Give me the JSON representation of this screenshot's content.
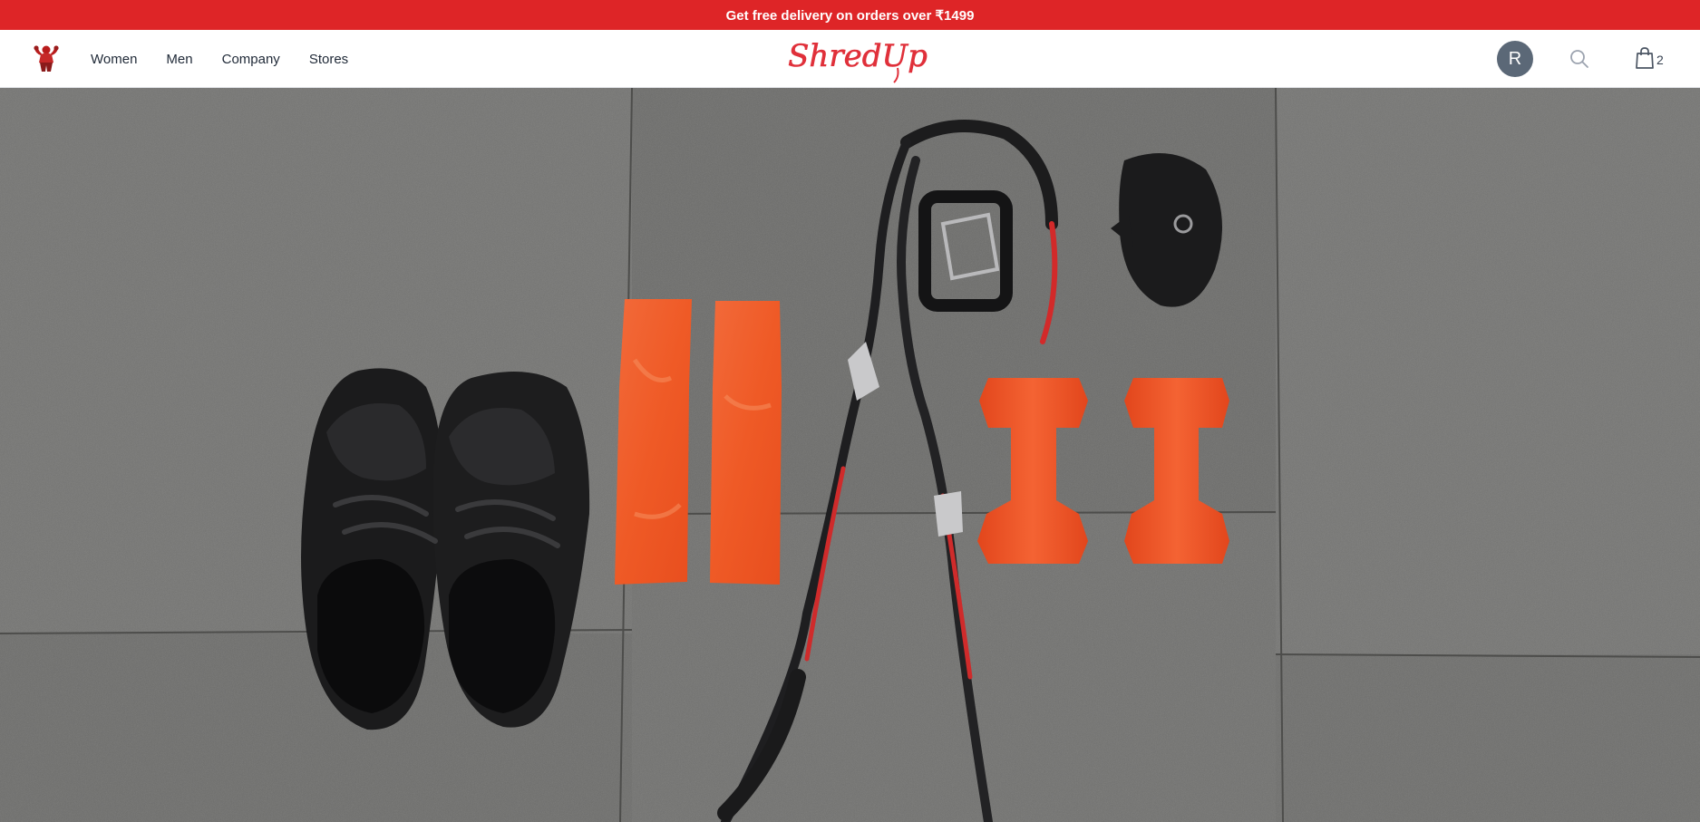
{
  "promo": {
    "text": "Get free delivery on orders over ₹1499"
  },
  "header": {
    "brand_icon": "flexing-bodybuilder-icon",
    "logo_text": "ShredUp",
    "nav": [
      {
        "label": "Women"
      },
      {
        "label": "Men"
      },
      {
        "label": "Company"
      },
      {
        "label": "Stores"
      }
    ],
    "user": {
      "initial": "R"
    },
    "search_icon": "search-icon",
    "cart": {
      "icon": "shopping-bag-icon",
      "count": "2"
    }
  },
  "colors": {
    "accent": "#de2527",
    "avatar_bg": "#5b6877",
    "hero_floor": "#6f6f6d",
    "product_orange": "#f15a24"
  },
  "hero": {
    "image": "flat-lay of black sneakers, orange resistance bands, suspension trainer straps and orange dumbbells on grey gym floor"
  }
}
